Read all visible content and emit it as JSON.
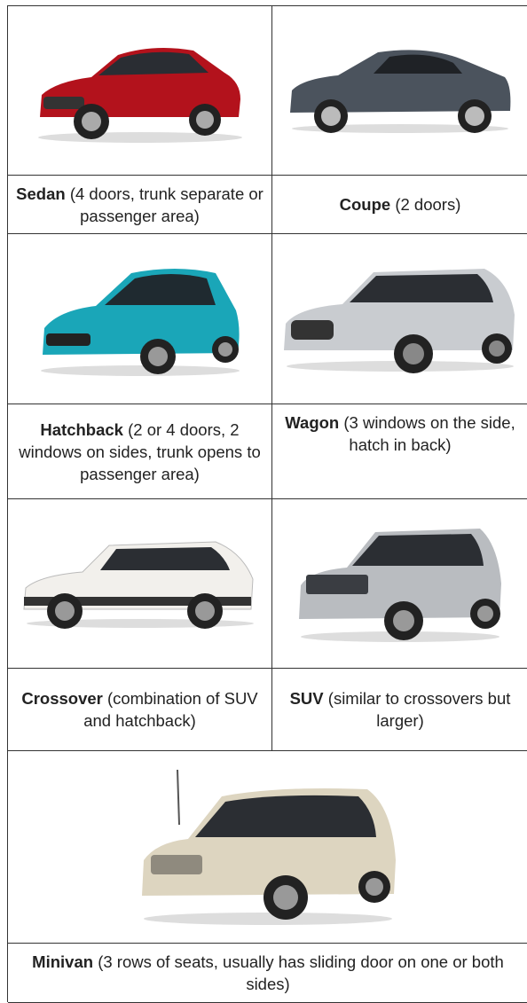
{
  "cars": [
    {
      "name": "Sedan",
      "desc": "(4 doors, trunk separate or passenger area)",
      "color": "#b3121c",
      "image": "red-sedan-image"
    },
    {
      "name": "Coupe",
      "desc": "(2 doors)",
      "color": "#4b535d",
      "image": "gray-coupe-image"
    },
    {
      "name": "Hatchback",
      "desc": "(2 or 4 doors, 2 windows on sides, trunk opens to passenger area)",
      "color": "#1aa6b8",
      "image": "teal-hatchback-image"
    },
    {
      "name": "Wagon",
      "desc": "(3 windows on the side, hatch in back)",
      "color": "#c9ccd0",
      "image": "silver-wagon-image"
    },
    {
      "name": "Crossover",
      "desc": "(combination of SUV and hatchback)",
      "color": "#f2f0ec",
      "image": "white-crossover-image"
    },
    {
      "name": "SUV",
      "desc": "(similar to crossovers but larger)",
      "color": "#b9bcc0",
      "image": "silver-suv-image"
    },
    {
      "name": "Minivan",
      "desc": "(3 rows of seats, usually has sliding door on one or both sides)",
      "color": "#ddd5c0",
      "image": "champagne-minivan-image"
    }
  ]
}
